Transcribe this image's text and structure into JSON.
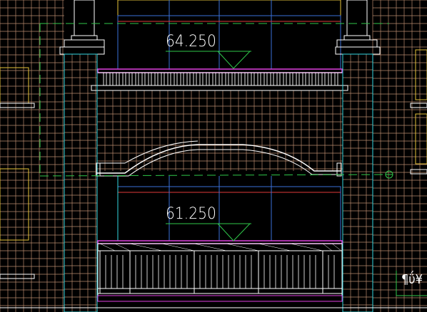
{
  "drawing": {
    "background": "#000000",
    "colors": {
      "grid": "#b98a6e",
      "wall_fill_line": "#c08a66",
      "cyan": "#33d6e0",
      "magenta": "#e040e0",
      "green_dash": "#2fc84a",
      "yellow": "#e6c33a",
      "white": "#ffffff",
      "blue_frame": "#3a6fd8",
      "red": "#e03a3a"
    },
    "elevation_upper": "64.250",
    "elevation_lower": "61.250",
    "corner_text": "¶ΰ¥"
  }
}
